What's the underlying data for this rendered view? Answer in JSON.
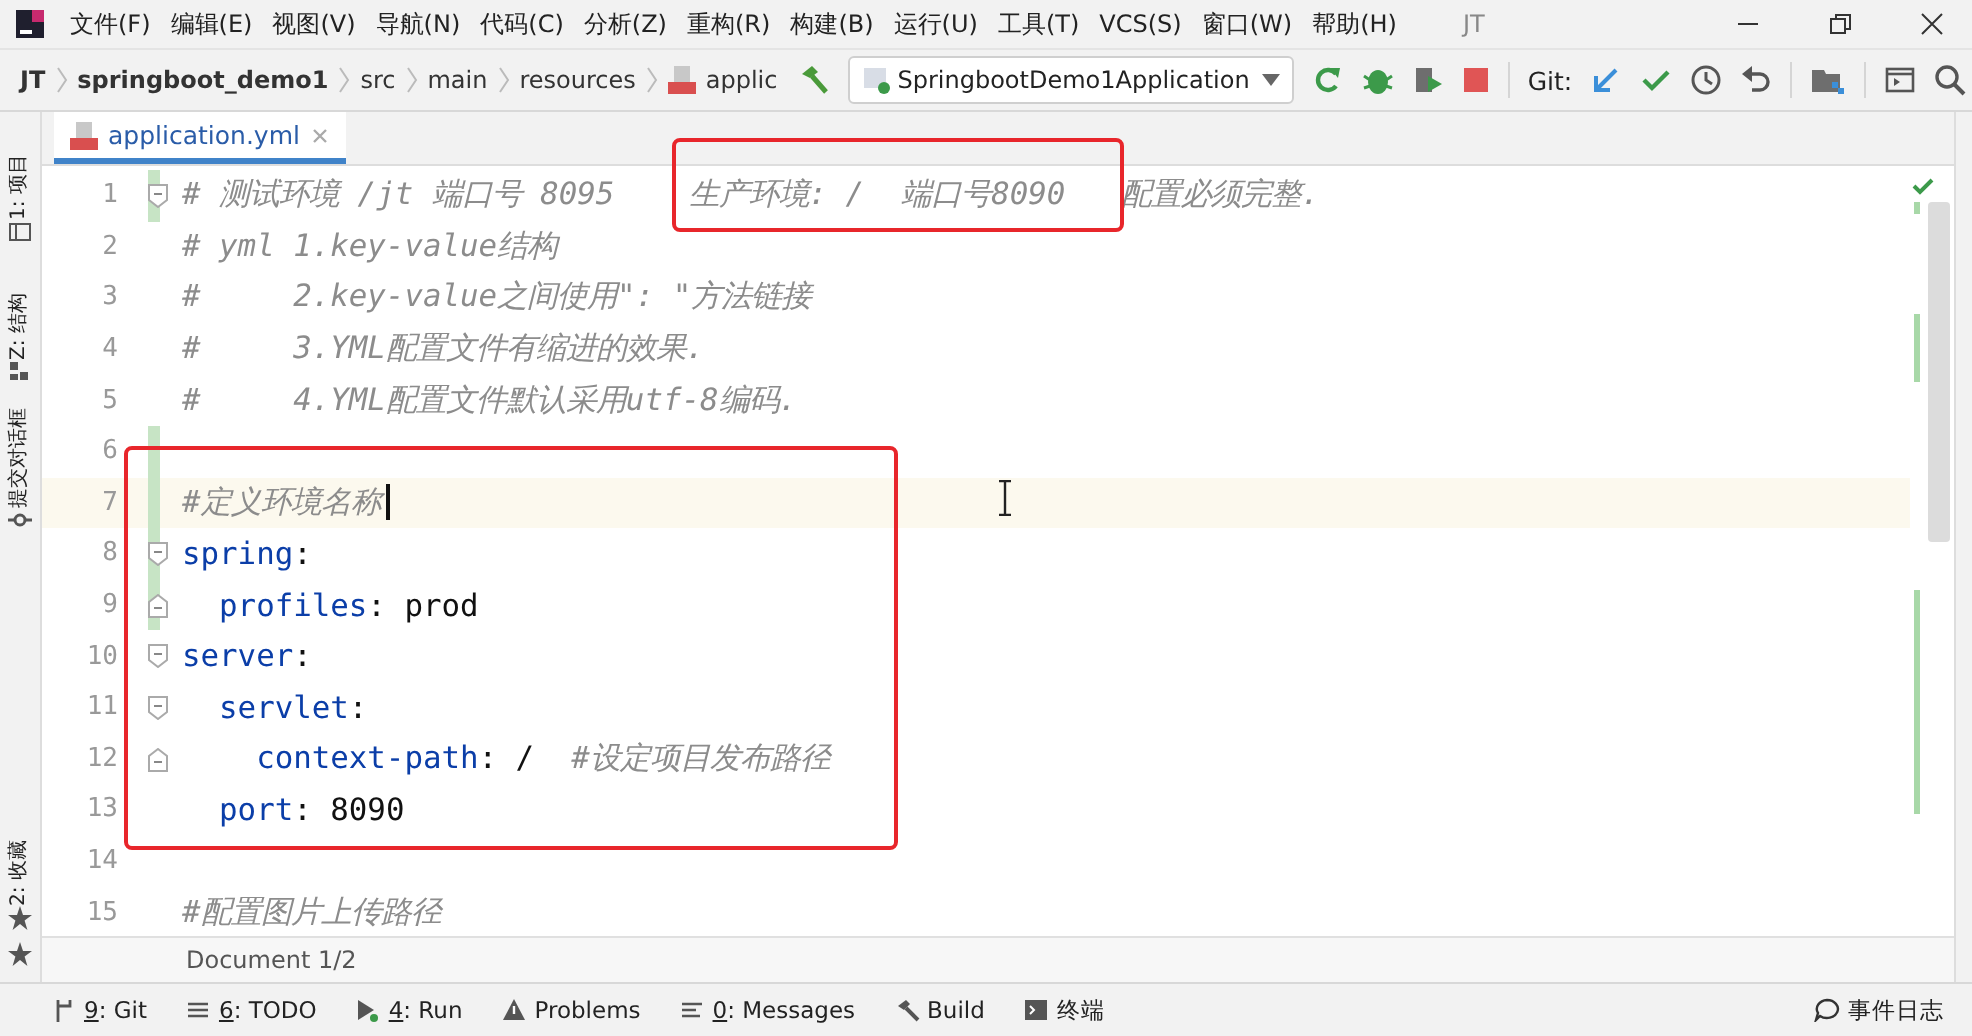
{
  "window": {
    "title": "JT"
  },
  "menu": [
    "文件(F)",
    "编辑(E)",
    "视图(V)",
    "导航(N)",
    "代码(C)",
    "分析(Z)",
    "重构(R)",
    "构建(B)",
    "运行(U)",
    "工具(T)",
    "VCS(S)",
    "窗口(W)",
    "帮助(H)"
  ],
  "breadcrumbs": [
    {
      "label": "JT",
      "kind": "project"
    },
    {
      "label": "springboot_demo1",
      "kind": "project"
    },
    {
      "label": "src",
      "kind": "folder"
    },
    {
      "label": "main",
      "kind": "folder"
    },
    {
      "label": "resources",
      "kind": "folder"
    },
    {
      "label": "applic",
      "kind": "file"
    }
  ],
  "run_config": "SpringbootDemo1Application",
  "git_label": "Git:",
  "left_tools": [
    {
      "label": "1: 项目",
      "kind": "project"
    },
    {
      "label": "Z: 结构",
      "kind": "structure"
    },
    {
      "label": "提交对话框",
      "kind": "commit"
    },
    {
      "label": "2: 收藏",
      "kind": "favorites"
    }
  ],
  "tabs": [
    {
      "label": "application.yml",
      "selected": true
    }
  ],
  "editor": {
    "lines": [
      {
        "number": "1",
        "fold_open": true,
        "fold_close": false,
        "changed": true,
        "current": false,
        "tokens": [
          {
            "kind": "comment",
            "text": "# 测试环境 /jt 端口号 8095    生产环境: /  端口号8090   配置必须完整."
          }
        ]
      },
      {
        "number": "2",
        "fold_open": false,
        "fold_close": false,
        "changed": false,
        "current": false,
        "tokens": [
          {
            "kind": "comment",
            "text": "# yml 1.key-value结构"
          }
        ]
      },
      {
        "number": "3",
        "fold_open": false,
        "fold_close": false,
        "changed": false,
        "current": false,
        "tokens": [
          {
            "kind": "comment",
            "text": "#     2.key-value之间使用\": \"方法链接"
          }
        ]
      },
      {
        "number": "4",
        "fold_open": false,
        "fold_close": false,
        "changed": false,
        "current": false,
        "tokens": [
          {
            "kind": "comment",
            "text": "#     3.YML配置文件有缩进的效果."
          }
        ]
      },
      {
        "number": "5",
        "fold_open": false,
        "fold_close": false,
        "changed": false,
        "current": false,
        "tokens": [
          {
            "kind": "comment",
            "text": "#     4.YML配置文件默认采用utf-8编码."
          }
        ]
      },
      {
        "number": "6",
        "fold_open": false,
        "fold_close": false,
        "changed": true,
        "current": false
      },
      {
        "number": "7",
        "fold_open": false,
        "fold_close": false,
        "changed": true,
        "current": true,
        "tokens": [
          {
            "kind": "comment",
            "text": "#定义环境名称"
          }
        ]
      },
      {
        "number": "8",
        "fold_open": true,
        "fold_close": false,
        "changed": true,
        "current": false,
        "tokens": [
          {
            "kind": "key",
            "text": "spring"
          },
          {
            "kind": "plain",
            "text": ":"
          }
        ]
      },
      {
        "number": "9",
        "fold_open": false,
        "fold_close": true,
        "changed": true,
        "current": false,
        "tokens": [
          {
            "kind": "key",
            "text": "  profiles"
          },
          {
            "kind": "plain",
            "text": ": prod"
          }
        ]
      },
      {
        "number": "10",
        "fold_open": true,
        "fold_close": false,
        "changed": false,
        "current": false,
        "tokens": [
          {
            "kind": "key",
            "text": "server"
          },
          {
            "kind": "plain",
            "text": ":"
          }
        ]
      },
      {
        "number": "11",
        "fold_open": true,
        "fold_close": false,
        "changed": false,
        "current": false,
        "tokens": [
          {
            "kind": "key",
            "text": "  servlet"
          },
          {
            "kind": "plain",
            "text": ":"
          }
        ]
      },
      {
        "number": "12",
        "fold_open": false,
        "fold_close": true,
        "changed": false,
        "current": false,
        "tokens": [
          {
            "kind": "key",
            "text": "    context-path"
          },
          {
            "kind": "plain",
            "text": ": /  "
          },
          {
            "kind": "comment",
            "text": "#设定项目发布路径"
          }
        ]
      },
      {
        "number": "13",
        "fold_open": false,
        "fold_close": false,
        "changed": false,
        "current": false,
        "tokens": [
          {
            "kind": "key",
            "text": "  port"
          },
          {
            "kind": "plain",
            "text": ": 8090"
          }
        ]
      },
      {
        "number": "14",
        "fold_open": false,
        "fold_close": false,
        "changed": false,
        "current": false
      },
      {
        "number": "15",
        "fold_open": false,
        "fold_close": false,
        "changed": false,
        "current": false,
        "tokens": [
          {
            "kind": "comment",
            "text": "#配置图片上传路径"
          }
        ]
      }
    ]
  },
  "status": "Document 1/2",
  "bottom_tools": [
    {
      "key": "9",
      "label": ": Git",
      "kind": "git"
    },
    {
      "key": "6",
      "label": ": TODO",
      "kind": "todo"
    },
    {
      "key": "4",
      "label": ": Run",
      "kind": "run"
    },
    {
      "label": "Problems",
      "kind": "problems"
    },
    {
      "key": "0",
      "label": ": Messages",
      "kind": "messages"
    },
    {
      "label": "Build",
      "kind": "build"
    },
    {
      "label": "终端",
      "kind": "terminal"
    }
  ],
  "event_log": "事件日志"
}
